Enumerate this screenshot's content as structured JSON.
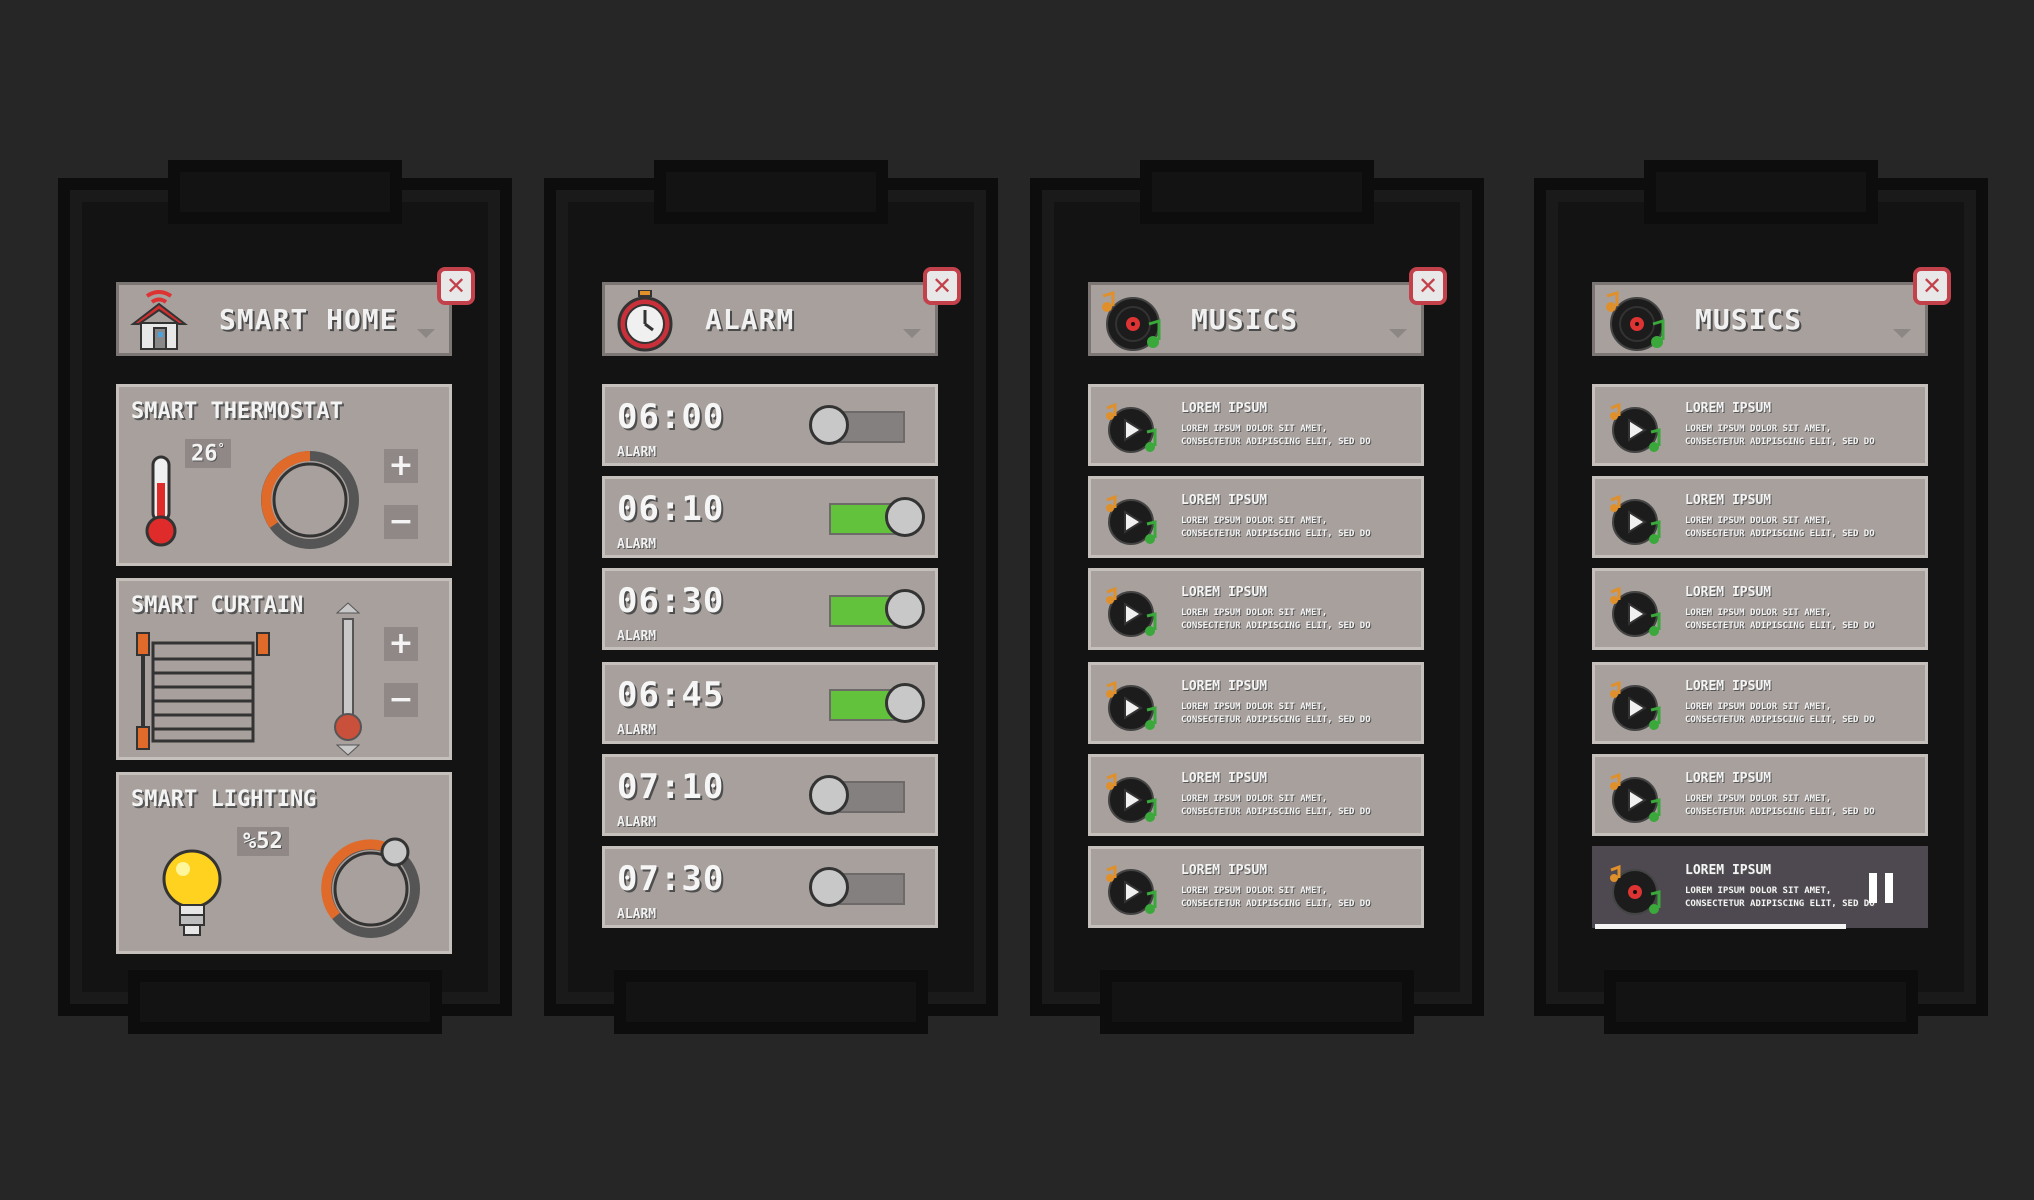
{
  "colors": {
    "background": "#262626",
    "panel": "#a7a09d",
    "toggle_on": "#62c23c",
    "close": "#c2414b",
    "playing_row": "#4e4850"
  },
  "smart_home": {
    "title": "SMART HOME",
    "header_icon": "house-wifi-icon",
    "thermostat": {
      "title": "SMART THERMOSTAT",
      "value": "26",
      "degree": "°",
      "icon": "thermometer-icon"
    },
    "curtain": {
      "title": "SMART CURTAIN",
      "icon": "curtain-icon",
      "level": 0.15
    },
    "lighting": {
      "title": "SMART LIGHTING",
      "value": "%52",
      "icon": "light-bulb-icon",
      "level": 0.52
    },
    "plus": "+",
    "minus": "−"
  },
  "alarm": {
    "title": "ALARM",
    "header_icon": "stopwatch-icon",
    "items": [
      {
        "time": "06:00",
        "label": "ALARM",
        "on": false
      },
      {
        "time": "06:10",
        "label": "ALARM",
        "on": true
      },
      {
        "time": "06:30",
        "label": "ALARM",
        "on": true
      },
      {
        "time": "06:45",
        "label": "ALARM",
        "on": true
      },
      {
        "time": "07:10",
        "label": "ALARM",
        "on": false
      },
      {
        "time": "07:30",
        "label": "ALARM",
        "on": false
      }
    ]
  },
  "musics_a": {
    "title": "MUSICS",
    "header_icon": "vinyl-record-icon",
    "items": [
      {
        "title": "LOREM IPSUM",
        "desc": "LOREM IPSUM DOLOR SIT AMET, CONSECTETUR ADIPISCING ELIT, SED DO"
      },
      {
        "title": "LOREM IPSUM",
        "desc": "LOREM IPSUM DOLOR SIT AMET, CONSECTETUR ADIPISCING ELIT, SED DO"
      },
      {
        "title": "LOREM IPSUM",
        "desc": "LOREM IPSUM DOLOR SIT AMET, CONSECTETUR ADIPISCING ELIT, SED DO"
      },
      {
        "title": "LOREM IPSUM",
        "desc": "LOREM IPSUM DOLOR SIT AMET, CONSECTETUR ADIPISCING ELIT, SED DO"
      },
      {
        "title": "LOREM IPSUM",
        "desc": "LOREM IPSUM DOLOR SIT AMET, CONSECTETUR ADIPISCING ELIT, SED DO"
      },
      {
        "title": "LOREM IPSUM",
        "desc": "LOREM IPSUM DOLOR SIT AMET, CONSECTETUR ADIPISCING ELIT, SED DO"
      }
    ]
  },
  "musics_b": {
    "title": "MUSICS",
    "header_icon": "vinyl-record-icon",
    "playing_index": 5,
    "progress": 0.76,
    "items": [
      {
        "title": "LOREM IPSUM",
        "desc": "LOREM IPSUM DOLOR SIT AMET, CONSECTETUR ADIPISCING ELIT, SED DO"
      },
      {
        "title": "LOREM IPSUM",
        "desc": "LOREM IPSUM DOLOR SIT AMET, CONSECTETUR ADIPISCING ELIT, SED DO"
      },
      {
        "title": "LOREM IPSUM",
        "desc": "LOREM IPSUM DOLOR SIT AMET, CONSECTETUR ADIPISCING ELIT, SED DO"
      },
      {
        "title": "LOREM IPSUM",
        "desc": "LOREM IPSUM DOLOR SIT AMET, CONSECTETUR ADIPISCING ELIT, SED DO"
      },
      {
        "title": "LOREM IPSUM",
        "desc": "LOREM IPSUM DOLOR SIT AMET, CONSECTETUR ADIPISCING ELIT, SED DO"
      },
      {
        "title": "LOREM IPSUM",
        "desc": "LOREM IPSUM DOLOR SIT AMET, CONSECTETUR ADIPISCING ELIT, SED DO"
      }
    ]
  }
}
